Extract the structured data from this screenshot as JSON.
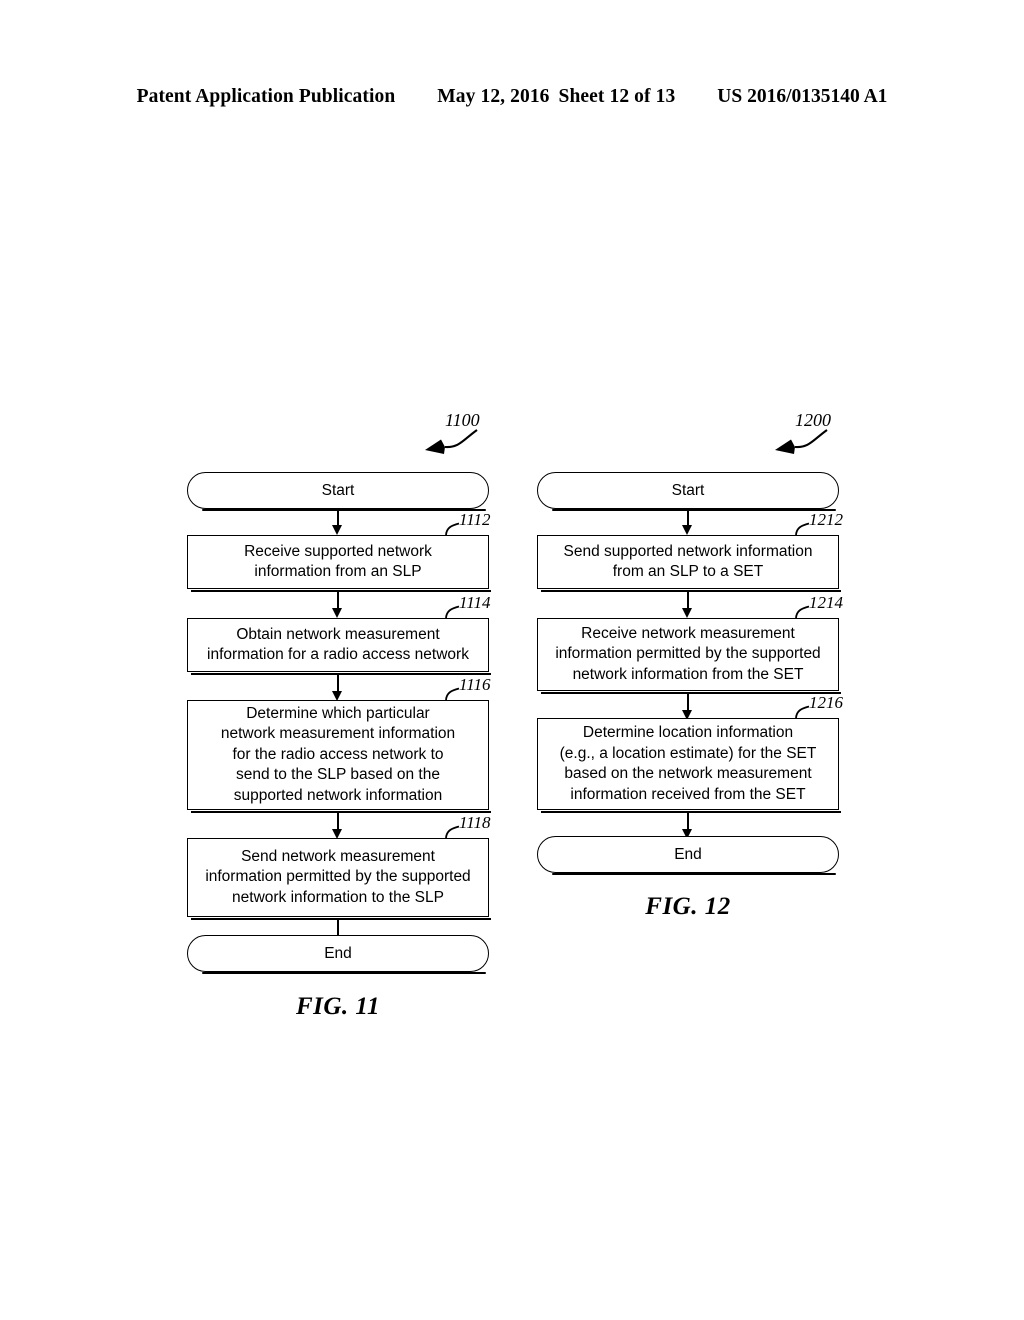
{
  "header": {
    "publication": "Patent Application Publication",
    "date": "May 12, 2016",
    "sheet": "Sheet 12 of 13",
    "patent_number": "US 2016/0135140 A1"
  },
  "figures": [
    {
      "id": "fig-11",
      "callout_number": "1100",
      "caption": "FIG. 11",
      "start_label": "Start",
      "end_label": "End",
      "steps": [
        {
          "ref": "1112",
          "text": "Receive supported network\ninformation from an SLP"
        },
        {
          "ref": "1114",
          "text": "Obtain network measurement\ninformation for a radio access network"
        },
        {
          "ref": "1116",
          "text": "Determine which particular\nnetwork measurement information\nfor the radio access network to\nsend to the SLP based on the\nsupported network information"
        },
        {
          "ref": "1118",
          "text": "Send network measurement\ninformation permitted by the supported\nnetwork information to the SLP"
        }
      ]
    },
    {
      "id": "fig-12",
      "callout_number": "1200",
      "caption": "FIG. 12",
      "start_label": "Start",
      "end_label": "End",
      "steps": [
        {
          "ref": "1212",
          "text": "Send supported network information\nfrom an SLP to a SET"
        },
        {
          "ref": "1214",
          "text": "Receive network measurement\ninformation permitted by the supported\nnetwork information from the SET"
        },
        {
          "ref": "1216",
          "text": "Determine location information\n(e.g., a location estimate) for the SET\nbased on the network measurement\ninformation received from the SET"
        }
      ]
    }
  ]
}
